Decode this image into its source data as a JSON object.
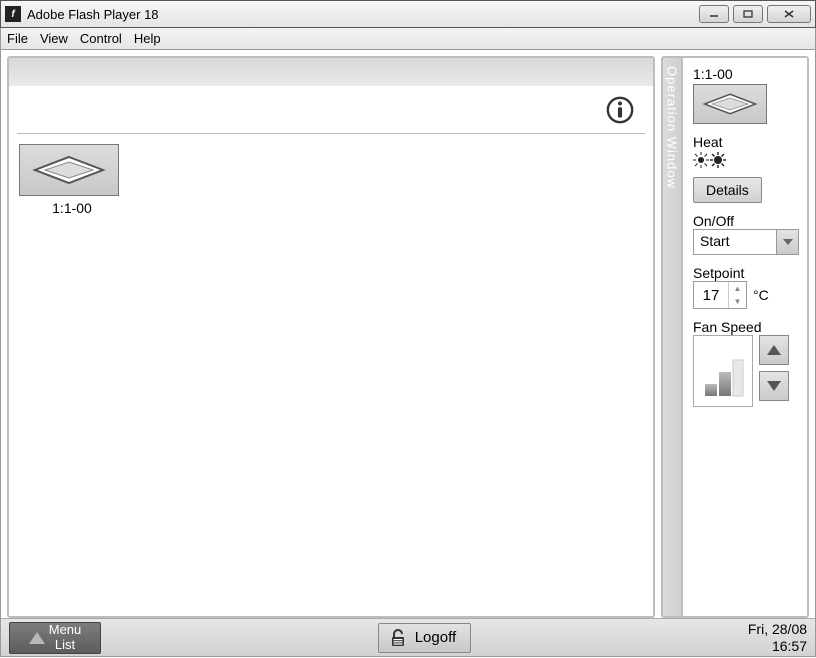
{
  "window": {
    "title": "Adobe Flash Player 18"
  },
  "menubar": {
    "items": [
      "File",
      "View",
      "Control",
      "Help"
    ]
  },
  "main": {
    "unit": {
      "label": "1:1-00"
    }
  },
  "side": {
    "tab_label": "Operation Window",
    "unit_label": "1:1-00",
    "mode_label": "Heat",
    "details_label": "Details",
    "onoff": {
      "label": "On/Off",
      "value": "Start"
    },
    "setpoint": {
      "label": "Setpoint",
      "value": "17",
      "unit": "°C"
    },
    "fan": {
      "label": "Fan Speed"
    }
  },
  "bottom": {
    "menu_label": "Menu\nList",
    "logoff_label": "Logoff",
    "date": "Fri, 28/08",
    "time": "16:57"
  }
}
